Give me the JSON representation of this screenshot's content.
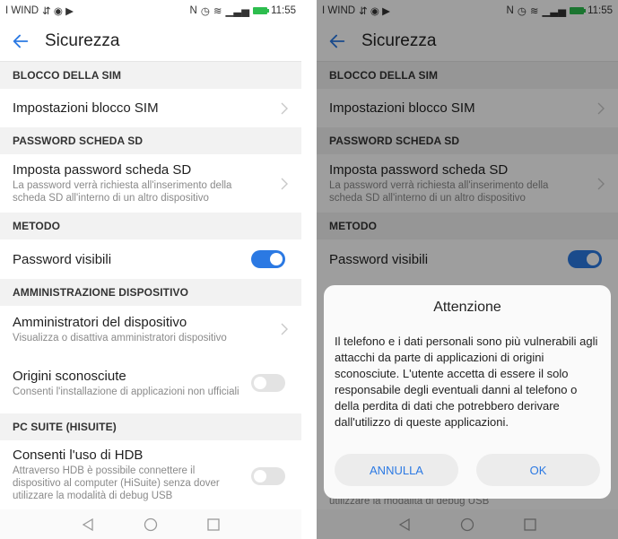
{
  "status": {
    "carrier": "I WIND",
    "time": "11:55"
  },
  "header": {
    "title": "Sicurezza"
  },
  "sections": {
    "sim": "BLOCCO DELLA SIM",
    "sd": "PASSWORD SCHEDA SD",
    "metodo": "METODO",
    "admin": "AMMINISTRAZIONE DISPOSITIVO",
    "pc": "PC SUITE (HISUITE)"
  },
  "items": {
    "sim_lock": {
      "title": "Impostazioni blocco SIM"
    },
    "sd_password": {
      "title": "Imposta password scheda SD",
      "subtitle": "La password verrà richiesta all'inserimento della scheda SD all'interno di un altro dispositivo"
    },
    "password_visible": {
      "title": "Password visibili",
      "on": true
    },
    "admins": {
      "title": "Amministratori del dispositivo",
      "subtitle": "Visualizza o disattiva amministratori dispositivo"
    },
    "unknown_sources": {
      "title": "Origini sconosciute",
      "subtitle": "Consenti l'installazione di applicazioni non ufficiali",
      "on": false
    },
    "hdb": {
      "title": "Consenti l'uso di HDB",
      "subtitle": "Attraverso HDB è possibile connettere il dispositivo al computer (HiSuite) senza dover utilizzare la modalità di debug USB",
      "on": false
    }
  },
  "right_partial": {
    "row_tail": "utilizzare la modalità di debug USB"
  },
  "dialog": {
    "title": "Attenzione",
    "message": "Il telefono e i dati personali sono più vulnerabili agli attacchi da parte di applicazioni di origini sconosciute. L'utente accetta di essere il solo responsabile degli eventuali danni al telefono o della perdita di dati che potrebbero derivare dall'utilizzo di queste applicazioni.",
    "cancel": "ANNULLA",
    "ok": "OK"
  },
  "colors": {
    "accent": "#2b79e3",
    "section_bg": "#f2f2f2",
    "toggle_off": "#e3e3e3"
  },
  "icons": [
    "back-arrow-icon",
    "chevron-right-icon",
    "nav-back-icon",
    "nav-home-icon",
    "nav-recents-icon",
    "nfc-icon",
    "alarm-icon",
    "wifi-icon",
    "signal-icon",
    "battery-icon"
  ]
}
